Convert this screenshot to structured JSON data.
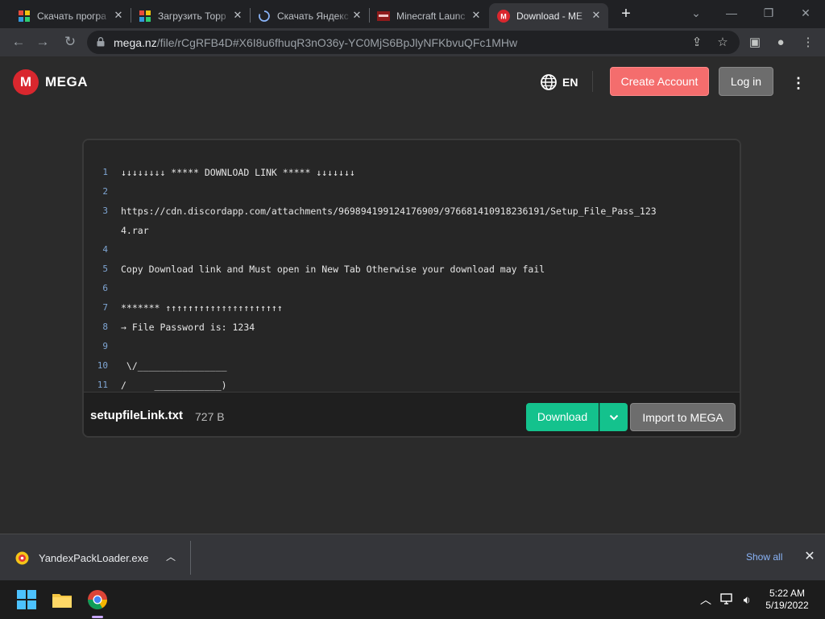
{
  "browser": {
    "tabs": [
      {
        "title": "Скачать програ",
        "favicon": "colorful-squares-icon",
        "active": false
      },
      {
        "title": "Загрузить Торр",
        "favicon": "colorful-squares-icon",
        "active": false
      },
      {
        "title": "Скачать Яндекс",
        "favicon": "loading-spinner-icon",
        "active": false
      },
      {
        "title": "Minecraft Launc",
        "favicon": "minecraft-icon",
        "active": false
      },
      {
        "title": "Download - ME",
        "favicon": "mega-icon",
        "active": true
      }
    ],
    "new_tab": "+",
    "url_host": "mega.nz",
    "url_rest": "/file/rCgRFB4D#X6I8u6fhuqR3nO36y-YC0MjS6BpJlyNFKbvuQFc1MHw"
  },
  "header": {
    "logo_mark": "M",
    "logo_text": "MEGA",
    "language": "EN",
    "create_account": "Create Account",
    "login": "Log in",
    "menu": "⋮"
  },
  "preview": {
    "lines": [
      {
        "num": "1",
        "text": "↓↓↓↓↓↓↓↓ ***** DOWNLOAD LINK ***** ↓↓↓↓↓↓↓"
      },
      {
        "num": "2",
        "text": ""
      },
      {
        "num": "3",
        "text": "https://cdn.discordapp.com/attachments/969894199124176909/976681410918236191/Setup_File_Pass_123"
      },
      {
        "num": "",
        "text": "4.rar"
      },
      {
        "num": "4",
        "text": ""
      },
      {
        "num": "5",
        "text": "Copy Download link and Must open in New Tab Otherwise your download may fail"
      },
      {
        "num": "6",
        "text": ""
      },
      {
        "num": "7",
        "text": "******* ↑↑↑↑↑↑↑↑↑↑↑↑↑↑↑↑↑↑↑↑↑"
      },
      {
        "num": "8",
        "text": "→ File Password is: 1234"
      },
      {
        "num": "9",
        "text": ""
      },
      {
        "num": "10",
        "text": " \\/________________"
      },
      {
        "num": "11",
        "text": "/     ____________)"
      }
    ],
    "file_name": "setupfileLink.txt",
    "file_size": "727 B",
    "download": "Download",
    "import": "Import to MEGA"
  },
  "downloads": {
    "file": "YandexPackLoader.exe",
    "show_all": "Show all"
  },
  "taskbar": {
    "time": "5:22 AM",
    "date": "5/19/2022"
  }
}
